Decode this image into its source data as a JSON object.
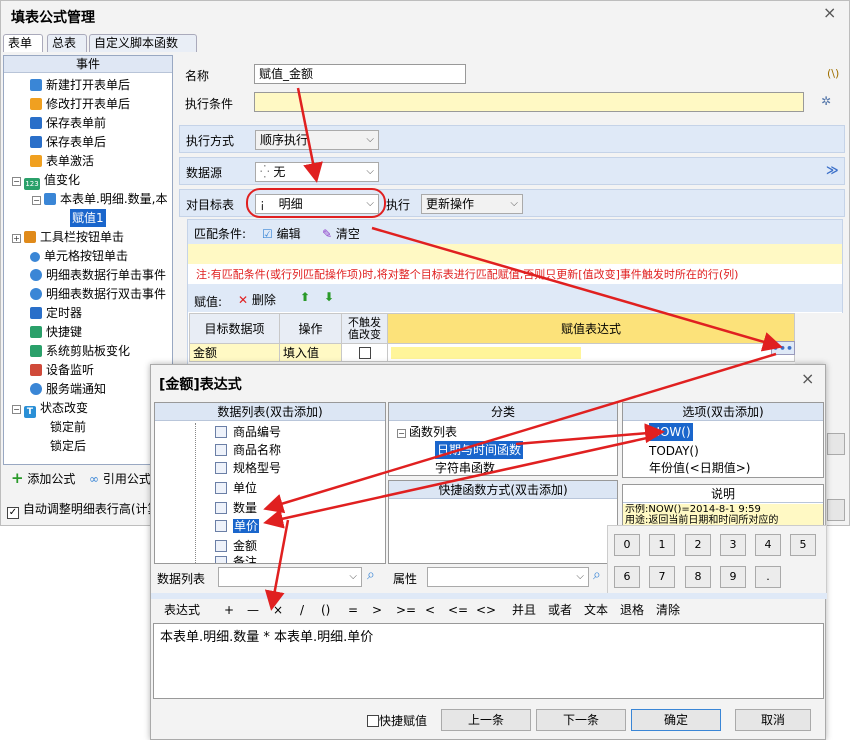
{
  "main": {
    "title": "填表公式管理",
    "close": "×",
    "tabs": [
      "表单",
      "总表",
      "自定义脚本函数"
    ]
  },
  "left": {
    "header": "事件",
    "items": [
      "新建打开表单后",
      "修改打开表单后",
      "保存表单前",
      "保存表单后",
      "表单激活",
      "值变化",
      "本表单.明细.数量,本",
      "赋值1",
      "工具栏按钮单击",
      "单元格按钮单击",
      "明细表数据行单击事件",
      "明细表数据行双击事件",
      "定时器",
      "快捷键",
      "系统剪贴板变化",
      "设备监听",
      "服务端通知",
      "状态改变",
      "锁定前",
      "锁定后"
    ],
    "add": "添加公式",
    "ref": "引用公式",
    "auto": "自动调整明细表行高(计算"
  },
  "form": {
    "name_label": "名称",
    "name_value": "赋值_金额",
    "name_hint": "(\\)",
    "cond_label": "执行条件",
    "mode_label": "执行方式",
    "mode_value": "顺序执行",
    "src_label": "数据源",
    "src_value": "无",
    "target_label": "对目标表",
    "target_value": "明细",
    "exec_label": "执行",
    "exec_value": "更新操作",
    "match_label": "匹配条件:",
    "edit": "编辑",
    "clear": "清空",
    "note": "注:有匹配条件(或行列匹配操作项)时,将对整个目标表进行匹配赋值,否则只更新[值改变]事件触发时所在的行(列)",
    "assign_label": "赋值:",
    "delete": "删除",
    "cols": [
      "目标数据项",
      "操作",
      "不触发\n值改变",
      "赋值表达式"
    ],
    "row1": [
      "金额",
      "填入值"
    ]
  },
  "dlg": {
    "title": "[金额]表达式",
    "close": "×",
    "list_title": "数据列表(双击添加)",
    "list": [
      "商品编号",
      "商品名称",
      "规格型号",
      "单位",
      "数量",
      "单价",
      "金额",
      "备注"
    ],
    "cat_title": "分类",
    "cats": [
      "函数列表",
      "日期与时间函数",
      "字符串函数"
    ],
    "opt_title": "选项(双击添加)",
    "opts": [
      "NOW()",
      "TODAY()",
      "年份值(<日期值>)"
    ],
    "quick_title": "快捷函数方式(双击添加)",
    "desc_title": "说明",
    "desc1": "示例:NOW()=2014-8-1 9:59",
    "desc2": "用途:返回当前日期和时间所对应的",
    "keys": [
      "0",
      "1",
      "2",
      "3",
      "4",
      "5",
      "6",
      "7",
      "8",
      "9",
      "."
    ],
    "data_list_label": "数据列表",
    "prop_label": "属性",
    "ops": [
      "表达式",
      "+",
      "—",
      "×",
      "/",
      "()",
      "=",
      ">",
      ">=",
      "<",
      "<=",
      "<>",
      "并且",
      "或者",
      "文本",
      "退格",
      "清除"
    ],
    "expr": "本表单.明细.数量 * 本表单.明细.单价",
    "quick_chk": "快捷赋值",
    "prev": "上一条",
    "next": "下一条",
    "ok": "确定",
    "cancel": "取消"
  },
  "colors": {
    "accent": "#e02020",
    "select": "#1a66cc",
    "yellow": "#fff9c4"
  }
}
